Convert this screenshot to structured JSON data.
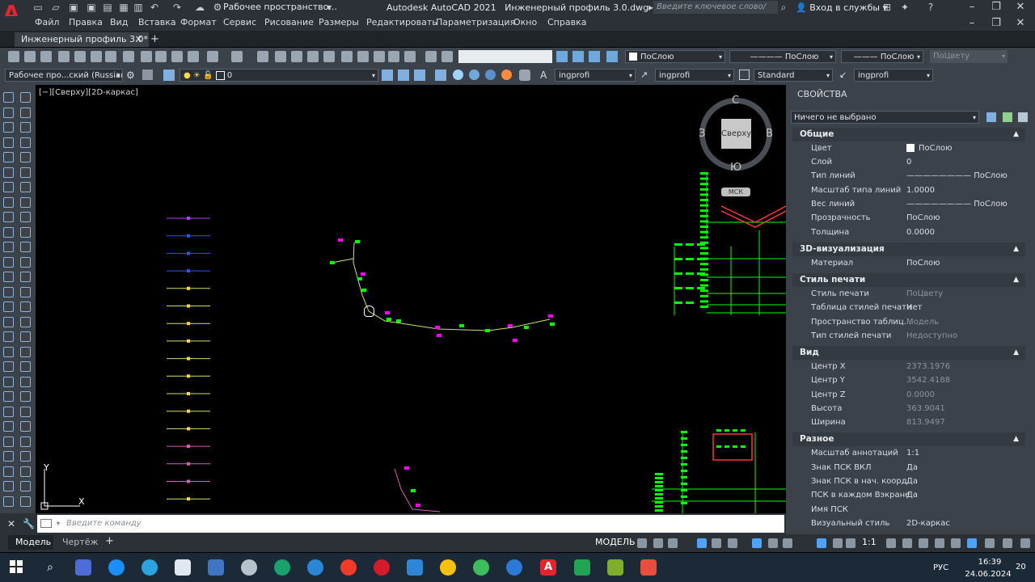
{
  "titlebar": {
    "workspace": "Рабочее пространство...",
    "app": "Autodesk AutoCAD 2021",
    "file": "Инженерный профиль 3.0.dwg",
    "search_placeholder": "Введите ключевое слово/фразу",
    "login": "Вход в службы"
  },
  "menu": [
    "Файл",
    "Правка",
    "Вид",
    "Вставка",
    "Формат",
    "Сервис",
    "Рисование",
    "Размеры",
    "Редактировать",
    "Параметризация",
    "Окно",
    "Справка"
  ],
  "doc_tab": "Инженерный профиль 3.0*",
  "toolbar1": {
    "color": "ПоСлою",
    "linetype": "ПоСлою",
    "lineweight": "ПоСлою",
    "plotstyle": "ПоЦвету"
  },
  "toolbar2": {
    "workspace": "Рабочее про...ский (Russian",
    "layer": "0",
    "text_style": "ingprofi",
    "dim_style": "ingprofi",
    "table_style": "Standard",
    "mleader_style": "ingprofi"
  },
  "viewport_label": "[−][Сверху][2D-каркас]",
  "viewcube": {
    "top": "Сверху",
    "n": "С",
    "s": "Ю",
    "w": "З",
    "e": "В",
    "ucs": "МСК"
  },
  "axes": {
    "y": "Y",
    "x": "X"
  },
  "command_placeholder": "Введите команду",
  "layout_tabs": [
    "Модель",
    "Чертёж"
  ],
  "status": {
    "model": "МОДЕЛЬ",
    "scale": "1:1"
  },
  "properties": {
    "title": "СВОЙСТВА",
    "selection": "Ничего не выбрано",
    "sections": {
      "general": {
        "title": "Общие",
        "rows": [
          {
            "label": "Цвет",
            "value": "ПоСлою"
          },
          {
            "label": "Слой",
            "value": "0"
          },
          {
            "label": "Тип линий",
            "value": "ПоСлою"
          },
          {
            "label": "Масштаб типа линий",
            "value": "1.0000"
          },
          {
            "label": "Вес линий",
            "value": "ПоСлою"
          },
          {
            "label": "Прозрачность",
            "value": "ПоСлою"
          },
          {
            "label": "Толщина",
            "value": "0.0000"
          }
        ]
      },
      "viz3d": {
        "title": "3D-визуализация",
        "rows": [
          {
            "label": "Материал",
            "value": "ПоСлою"
          }
        ]
      },
      "plot": {
        "title": "Стиль печати",
        "rows": [
          {
            "label": "Стиль печати",
            "value": "ПоЦвету"
          },
          {
            "label": "Таблица стилей печати",
            "value": "Нет"
          },
          {
            "label": "Пространство таблиц...",
            "value": "Модель"
          },
          {
            "label": "Тип стилей печати",
            "value": "Недоступно"
          }
        ]
      },
      "view": {
        "title": "Вид",
        "rows": [
          {
            "label": "Центр X",
            "value": "2373.1976"
          },
          {
            "label": "Центр Y",
            "value": "3542.4188"
          },
          {
            "label": "Центр Z",
            "value": "0.0000"
          },
          {
            "label": "Высота",
            "value": "363.9041"
          },
          {
            "label": "Ширина",
            "value": "813.9497"
          }
        ]
      },
      "misc": {
        "title": "Разное",
        "rows": [
          {
            "label": "Масштаб аннотаций",
            "value": "1:1"
          },
          {
            "label": "Знак ПСК ВКЛ",
            "value": "Да"
          },
          {
            "label": "Знак ПСК в нач. коорд.",
            "value": "Да"
          },
          {
            "label": "ПСК в каждом Вэкране",
            "value": "Да"
          },
          {
            "label": "Имя ПСК",
            "value": ""
          },
          {
            "label": "Визуальный стиль",
            "value": "2D-каркас"
          }
        ]
      }
    }
  },
  "taskbar": {
    "lang": "РУС",
    "time": "16:39",
    "date": "24.06.2024",
    "notif": "20"
  },
  "colors": {
    "bg": "#000000",
    "panel": "#3b4249",
    "accent_red": "#e5242b",
    "green": "#00ff00",
    "magenta": "#ff00ff"
  }
}
